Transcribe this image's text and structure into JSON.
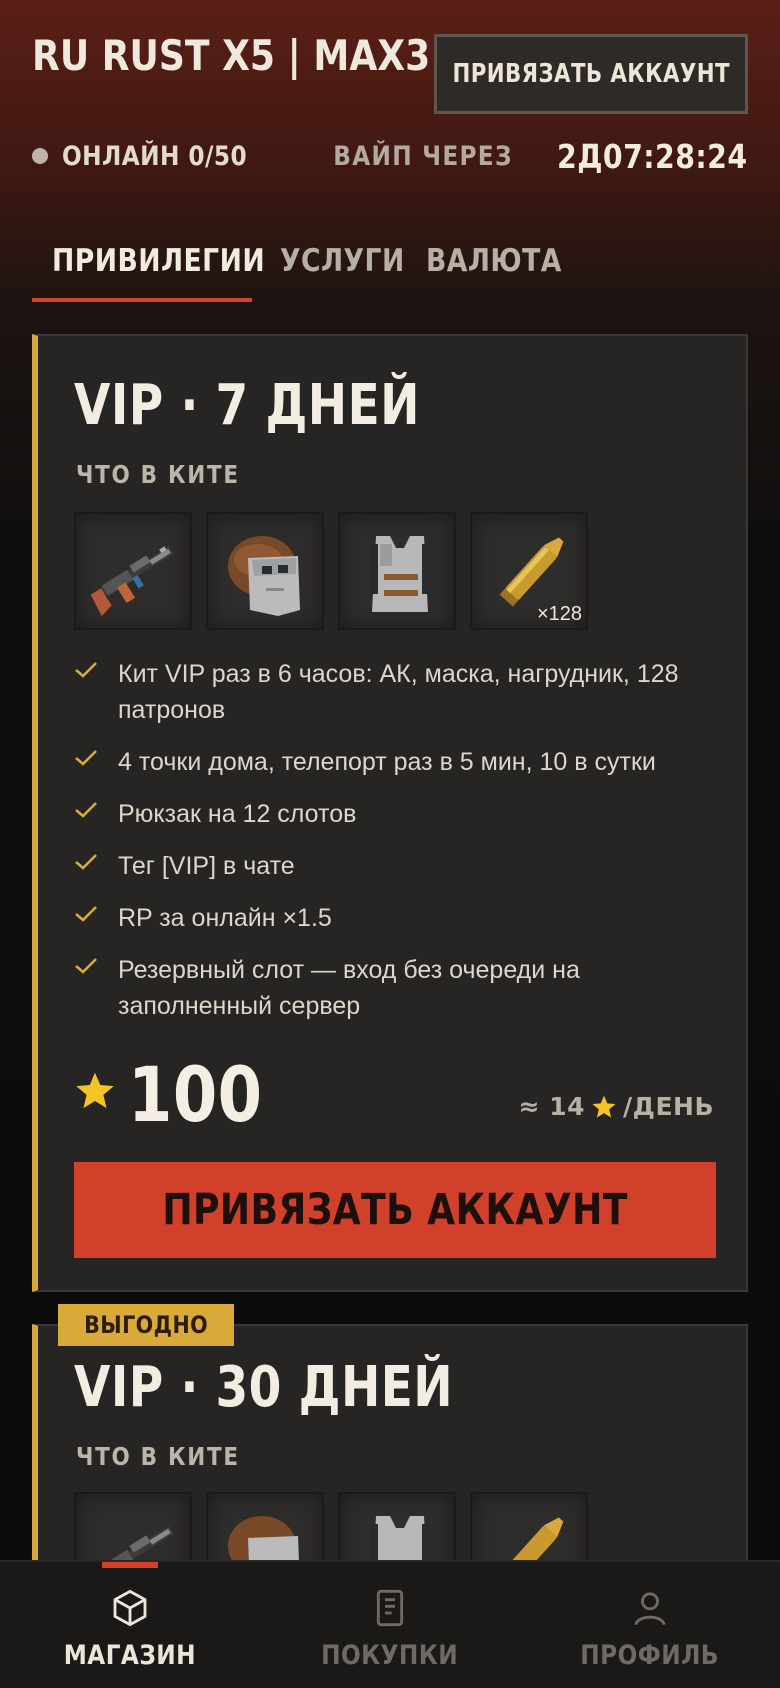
{
  "header": {
    "title": "RU RUST X5 | MAX3",
    "link_button": "ПРИВЯЗАТЬ АККАУНТ",
    "online": "ОНЛАЙН 0/50",
    "wipe_label": "ВАЙП ЧЕРЕЗ",
    "wipe_time": "2Д07:28:24"
  },
  "tabs": [
    {
      "label": "ПРИВИЛЕГИИ",
      "active": true
    },
    {
      "label": "УСЛУГИ",
      "active": false
    },
    {
      "label": "ВАЛЮТА",
      "active": false
    }
  ],
  "cards": [
    {
      "title": "VIP · 7 ДНЕЙ",
      "kit_label": "ЧТО В КИТЕ",
      "kit_items": [
        {
          "icon": "rifle-icon",
          "qty": ""
        },
        {
          "icon": "metal-facemask-icon",
          "qty": ""
        },
        {
          "icon": "chestplate-icon",
          "qty": ""
        },
        {
          "icon": "rifle-ammo-icon",
          "qty": "×128"
        }
      ],
      "features": [
        "Кит VIP раз в 6 часов: АК, маска, нагрудник, 128 патронов",
        "4 точки дома, телепорт раз в 5 мин, 10 в сутки",
        "Рюкзак на 12 слотов",
        "Тег [VIP] в чате",
        "RP за онлайн ×1.5",
        "Резервный слот — вход без очереди на заполненный сервер"
      ],
      "price": "100",
      "per_day_prefix": "≈ 14",
      "per_day_suffix": "/ДЕНЬ",
      "button": "ПРИВЯЗАТЬ АККАУНТ"
    },
    {
      "badge": "ВЫГОДНО",
      "title": "VIP · 30 ДНЕЙ",
      "kit_label": "ЧТО В КИТЕ"
    }
  ],
  "bottom_nav": [
    {
      "label": "МАГАЗИН",
      "icon": "box-icon",
      "active": true
    },
    {
      "label": "ПОКУПКИ",
      "icon": "receipt-icon",
      "active": false
    },
    {
      "label": "ПРОФИЛЬ",
      "icon": "user-icon",
      "active": false
    }
  ],
  "colors": {
    "accent": "#d0402a",
    "gold": "#d7a83a",
    "card_bg": "#262524",
    "check": "#d9a93a"
  }
}
